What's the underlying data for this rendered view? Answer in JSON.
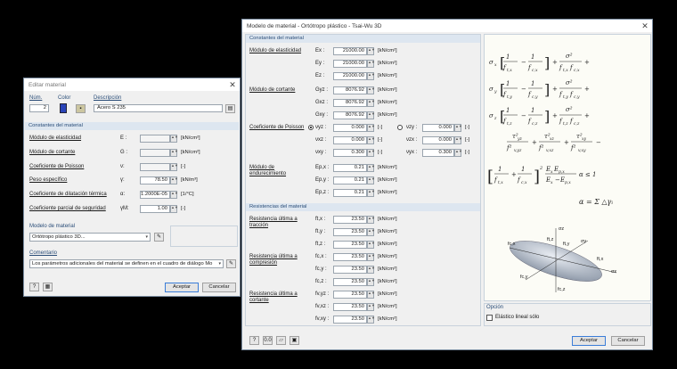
{
  "left": {
    "title": "Editar material",
    "num_label": "Núm.",
    "num_value": "2",
    "color_label": "Color",
    "desc_label": "Descripción",
    "desc_value": "Acero S 235",
    "section_constants": "Constantes del material",
    "rows": [
      {
        "label": "Módulo de elasticidad",
        "sym": "E :",
        "value": "",
        "unit": "[kN/cm²]"
      },
      {
        "label": "Módulo de cortante",
        "sym": "G :",
        "value": "",
        "unit": "[kN/cm²]"
      },
      {
        "label": "Coeficiente de Poisson",
        "sym": "ν:",
        "value": "",
        "unit": "[-]"
      },
      {
        "label": "Peso específico",
        "sym": "γ:",
        "value": "78.50",
        "unit": "[kN/m³]"
      },
      {
        "label": "Coeficiente de dilatación térmica",
        "sym": "α:",
        "value": "1.2000E-05",
        "unit": "[1/°C]"
      },
      {
        "label": "Coeficiente parcial de seguridad",
        "sym": "γM:",
        "value": "1.00",
        "unit": "[-]"
      }
    ],
    "model_label": "Modelo de material",
    "model_value": "Ortótropo plástico 3D...",
    "comment_label": "Comentario",
    "comment_value": "Los parámetros adicionales del material se definen en el cuadro de diálogo Mo",
    "ok": "Aceptar",
    "cancel": "Cancelar"
  },
  "right": {
    "title": "Modelo de material - Ortótropo plástico - Tsai-Wu 3D",
    "sec_constants": "Constantes del material",
    "elastic_label": "Módulo de elasticidad",
    "elastic": [
      {
        "sym": "Ex :",
        "value": "21000.00",
        "unit": "[kN/cm²]"
      },
      {
        "sym": "Ey :",
        "value": "21000.00",
        "unit": "[kN/cm²]"
      },
      {
        "sym": "Ez :",
        "value": "21000.00",
        "unit": "[kN/cm²]"
      }
    ],
    "shear_label": "Módulo de cortante",
    "shear": [
      {
        "sym": "Gyz :",
        "value": "8076.92",
        "unit": "[kN/cm²]"
      },
      {
        "sym": "Gxz :",
        "value": "8076.92",
        "unit": "[kN/cm²]"
      },
      {
        "sym": "Gxy :",
        "value": "8076.92",
        "unit": "[kN/cm²]"
      }
    ],
    "poisson_label": "Coeficiente de Poisson",
    "poisson_left": [
      {
        "sym": "νyz :",
        "value": "0.000",
        "unit": "[-]"
      },
      {
        "sym": "νxz :",
        "value": "0.000",
        "unit": "[-]"
      },
      {
        "sym": "νxy :",
        "value": "0.300",
        "unit": "[-]"
      }
    ],
    "poisson_right": [
      {
        "sym": "νzy :",
        "value": "0.000",
        "unit": "[-]"
      },
      {
        "sym": "νzx :",
        "value": "0.000",
        "unit": "[-]"
      },
      {
        "sym": "νyx :",
        "value": "0.300",
        "unit": "[-]"
      }
    ],
    "hard_label": "Módulo de endurecimiento",
    "hard": [
      {
        "sym": "Ep,x :",
        "value": "0.21",
        "unit": "[kN/cm²]"
      },
      {
        "sym": "Ep,y :",
        "value": "0.21",
        "unit": "[kN/cm²]"
      },
      {
        "sym": "Ep,z :",
        "value": "0.21",
        "unit": "[kN/cm²]"
      }
    ],
    "sec_resist": "Resistencias del material",
    "tension_label": "Resistencia última a tracción",
    "tension": [
      {
        "sym": "ft,x :",
        "value": "23.50",
        "unit": "[kN/cm²]"
      },
      {
        "sym": "ft,y :",
        "value": "23.50",
        "unit": "[kN/cm²]"
      },
      {
        "sym": "ft,z :",
        "value": "23.50",
        "unit": "[kN/cm²]"
      }
    ],
    "comp_label": "Resistencia última a compresión",
    "comp": [
      {
        "sym": "fc,x :",
        "value": "23.50",
        "unit": "[kN/cm²]"
      },
      {
        "sym": "fc,y :",
        "value": "23.50",
        "unit": "[kN/cm²]"
      },
      {
        "sym": "fc,z :",
        "value": "23.50",
        "unit": "[kN/cm²]"
      }
    ],
    "shear_res_label": "Resistencia última a cortante",
    "shear_res": [
      {
        "sym": "fv,yz :",
        "value": "23.50",
        "unit": "[kN/cm²]"
      },
      {
        "sym": "fv,xz :",
        "value": "23.50",
        "unit": "[kN/cm²]"
      },
      {
        "sym": "fv,xy :",
        "value": "23.50",
        "unit": "[kN/cm²]"
      }
    ],
    "option_label": "Opción",
    "option_check": "Elástico lineal sólo",
    "ok": "Aceptar",
    "cancel": "Cancelar",
    "formula_alpha": "α = Σ △γᵢ",
    "diagram_labels": [
      "σz",
      "ft,z",
      "ft,y",
      "σy",
      "ft,x",
      "σx",
      "fc,x",
      "fc,y",
      "fc,z"
    ]
  }
}
